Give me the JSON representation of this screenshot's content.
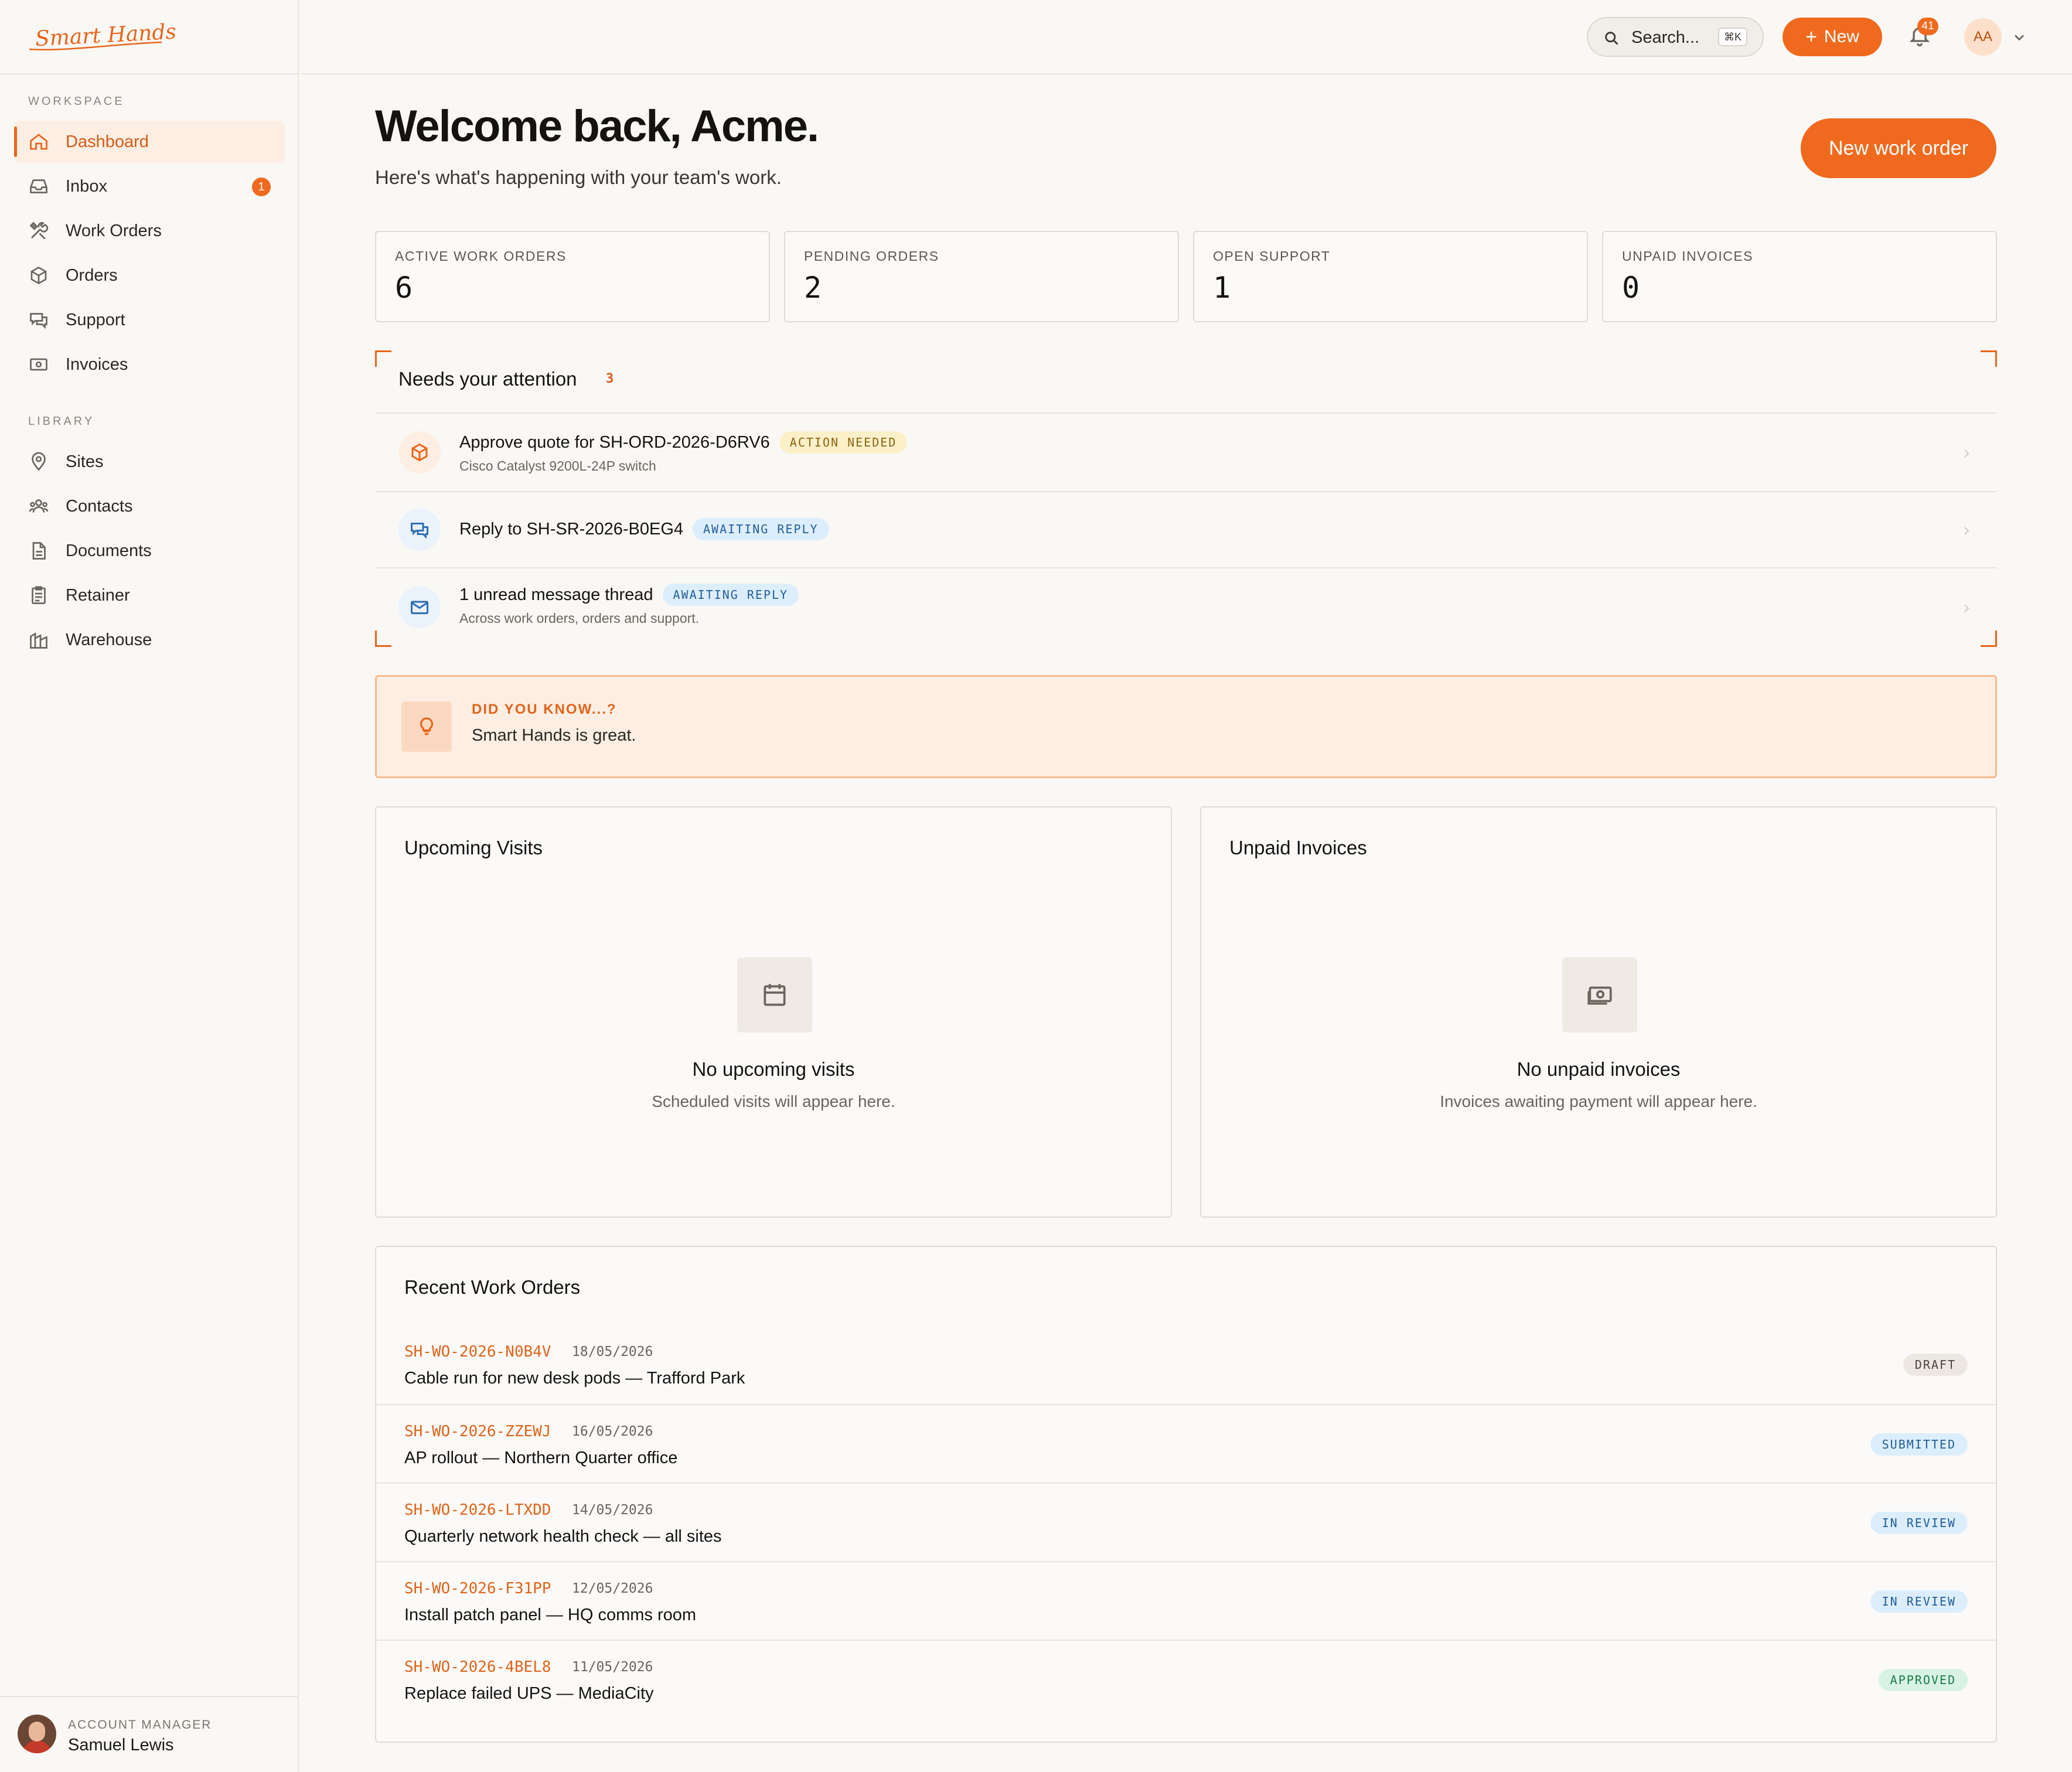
{
  "brand": {
    "logo": "Smart Hands",
    "accent": "#ef6a1e"
  },
  "sidebar": {
    "workspace_label": "WORKSPACE",
    "library_label": "LIBRARY",
    "workspace_items": [
      {
        "label": "Dashboard",
        "icon": "home-icon",
        "active": true
      },
      {
        "label": "Inbox",
        "icon": "inbox-icon",
        "badge": "1"
      },
      {
        "label": "Work Orders",
        "icon": "tools-icon"
      },
      {
        "label": "Orders",
        "icon": "box-icon"
      },
      {
        "label": "Support",
        "icon": "chat-icon"
      },
      {
        "label": "Invoices",
        "icon": "banknote-icon"
      }
    ],
    "library_items": [
      {
        "label": "Sites",
        "icon": "map-pin-icon"
      },
      {
        "label": "Contacts",
        "icon": "users-icon"
      },
      {
        "label": "Documents",
        "icon": "document-icon"
      },
      {
        "label": "Retainer",
        "icon": "clipboard-icon"
      },
      {
        "label": "Warehouse",
        "icon": "warehouse-icon"
      }
    ],
    "account": {
      "role": "ACCOUNT MANAGER",
      "name": "Samuel Lewis"
    }
  },
  "topbar": {
    "search_placeholder": "Search...",
    "search_shortcut": "⌘K",
    "new_label": "New",
    "notification_count": "41",
    "user_initials": "AA"
  },
  "header": {
    "title": "Welcome back, Acme.",
    "subtitle": "Here's what's happening with your team's work.",
    "cta": "New work order"
  },
  "stats": [
    {
      "label": "ACTIVE WORK ORDERS",
      "value": "6"
    },
    {
      "label": "PENDING ORDERS",
      "value": "2"
    },
    {
      "label": "OPEN SUPPORT",
      "value": "1"
    },
    {
      "label": "UNPAID INVOICES",
      "value": "0"
    }
  ],
  "attention": {
    "title": "Needs your attention",
    "count": "3",
    "items": [
      {
        "title": "Approve quote for SH-ORD-2026-D6RV6",
        "badge": "ACTION NEEDED",
        "subtitle": "Cisco Catalyst 9200L-24P switch",
        "icon": "box-icon"
      },
      {
        "title": "Reply to SH-SR-2026-B0EG4",
        "badge": "AWAITING REPLY",
        "subtitle": "",
        "icon": "chat-icon"
      },
      {
        "title": "1 unread message thread",
        "badge": "AWAITING REPLY",
        "subtitle": "Across work orders, orders and support.",
        "icon": "mail-icon"
      }
    ]
  },
  "tip": {
    "label": "DID YOU KNOW...?",
    "text": "Smart Hands is great."
  },
  "upcoming_visits": {
    "title": "Upcoming Visits",
    "empty_title": "No upcoming visits",
    "empty_sub": "Scheduled visits will appear here."
  },
  "unpaid_invoices": {
    "title": "Unpaid Invoices",
    "empty_title": "No unpaid invoices",
    "empty_sub": "Invoices awaiting payment will appear here."
  },
  "recent_work_orders": {
    "title": "Recent Work Orders",
    "rows": [
      {
        "id": "SH-WO-2026-N0B4V",
        "date": "18/05/2026",
        "title": "Cable run for new desk pods — Trafford Park",
        "status": "DRAFT"
      },
      {
        "id": "SH-WO-2026-ZZEWJ",
        "date": "16/05/2026",
        "title": "AP rollout — Northern Quarter office",
        "status": "SUBMITTED"
      },
      {
        "id": "SH-WO-2026-LTXDD",
        "date": "14/05/2026",
        "title": "Quarterly network health check — all sites",
        "status": "IN REVIEW"
      },
      {
        "id": "SH-WO-2026-F31PP",
        "date": "12/05/2026",
        "title": "Install patch panel — HQ comms room",
        "status": "IN REVIEW"
      },
      {
        "id": "SH-WO-2026-4BEL8",
        "date": "11/05/2026",
        "title": "Replace failed UPS — MediaCity",
        "status": "APPROVED"
      }
    ]
  }
}
